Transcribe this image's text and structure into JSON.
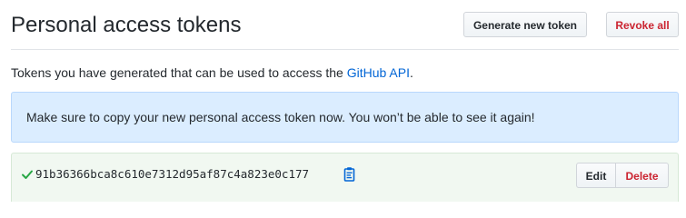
{
  "header": {
    "title": "Personal access tokens",
    "generate_label": "Generate new token",
    "revoke_label": "Revoke all"
  },
  "description": {
    "text": "Tokens you have generated that can be used to access the ",
    "link_text": "GitHub API",
    "suffix": "."
  },
  "flash": {
    "message": "Make sure to copy your new personal access token now. You won’t be able to see it again!"
  },
  "token": {
    "value": "91b36366bca8c610e7312d95af87c4a823e0c177",
    "status_icon": "check-icon",
    "copy_icon": "clipboard-icon",
    "edit_label": "Edit",
    "delete_label": "Delete"
  },
  "colors": {
    "link": "#0366d6",
    "danger": "#cb2431",
    "success": "#28a745",
    "flash_bg": "#dbedff",
    "token_bg": "#f1f8f1"
  }
}
